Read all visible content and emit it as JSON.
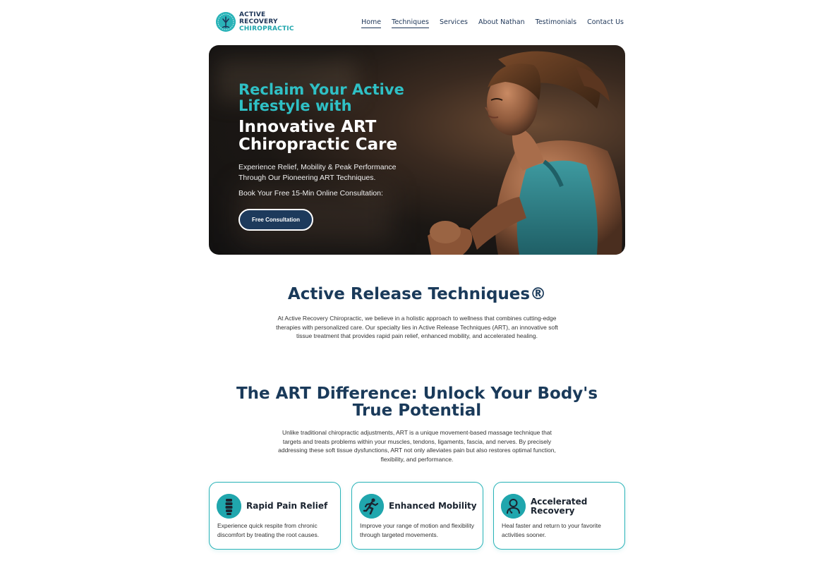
{
  "brand": {
    "line1": "ACTIVE",
    "line2": "RECOVERY",
    "line3": "CHIROPRACTIC"
  },
  "nav": {
    "items": [
      {
        "label": "Home"
      },
      {
        "label": "Techniques"
      },
      {
        "label": "Services"
      },
      {
        "label": "About Nathan"
      },
      {
        "label": "Testimonials"
      },
      {
        "label": "Contact Us"
      }
    ]
  },
  "hero": {
    "heading_teal": "Reclaim Your Active Lifestyle with",
    "heading_white": "Innovative ART Chiropractic Care",
    "subtitle": "Experience Relief, Mobility & Peak Performance Through Our Pioneering ART Techniques.",
    "book_text": "Book Your Free 15-Min Online Consultation:",
    "cta_label": "Free Consultation"
  },
  "art": {
    "title": "Active Release Techniques®",
    "body": "At Active Recovery Chiropractic, we believe in a holistic approach to wellness that combines cutting-edge therapies with personalized care. Our specialty lies in Active Release Techniques (ART), an innovative soft tissue treatment that provides rapid pain relief, enhanced mobility, and accelerated healing."
  },
  "difference": {
    "title": "The ART Difference: Unlock Your Body's True Potential",
    "body": "Unlike traditional chiropractic adjustments, ART is a unique movement-based massage technique that targets and treats problems within your muscles, tendons, ligaments, fascia, and nerves. By precisely addressing these soft tissue dysfunctions, ART not only alleviates pain but also restores optimal function, flexibility, and performance."
  },
  "cards": [
    {
      "icon": "spine-icon",
      "title": "Rapid Pain Relief",
      "desc": "Experience quick respite from chronic discomfort by treating the root causes."
    },
    {
      "icon": "runner-icon",
      "title": "Enhanced Mobility",
      "desc": "Improve your range of motion and flexibility through targeted movements."
    },
    {
      "icon": "doctor-icon",
      "title": "Accelerated Recovery",
      "desc": "Heal faster and return to your favorite activities sooner."
    }
  ],
  "colors": {
    "navy": "#1d3557",
    "teal": "#2ab3b8",
    "heading": "#1a3a5a"
  }
}
